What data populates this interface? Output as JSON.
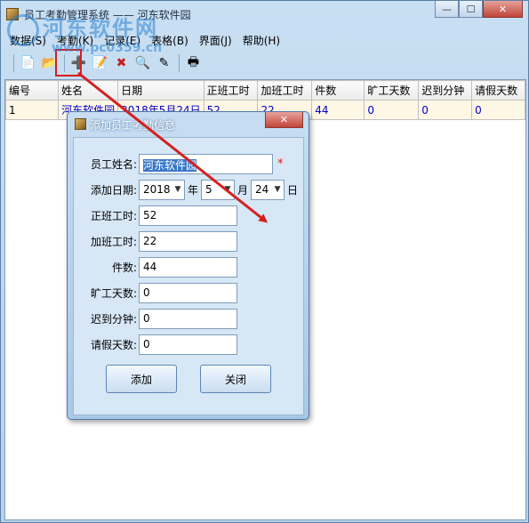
{
  "window": {
    "title": "员工考勤管理系统 —— 河东软件园",
    "controls": {
      "minimize": "—",
      "maximize": "☐",
      "close": "✕"
    }
  },
  "watermark": {
    "text": "河东软件网",
    "url": "www.pc0359.cn"
  },
  "menubar": {
    "items": [
      {
        "label": "数据(S)"
      },
      {
        "label": "考勤(K)"
      },
      {
        "label": "记录(E)"
      },
      {
        "label": "表格(B)"
      },
      {
        "label": "界面(J)"
      },
      {
        "label": "帮助(H)"
      }
    ]
  },
  "toolbar": {
    "buttons": [
      {
        "icon": "new-document-icon",
        "glyph": "📄"
      },
      {
        "icon": "open-folder-icon",
        "glyph": "📂"
      },
      {
        "icon": "add-record-icon",
        "glyph": "➕"
      },
      {
        "icon": "edit-document-icon",
        "glyph": "📝"
      },
      {
        "icon": "delete-icon",
        "glyph": "✖"
      },
      {
        "icon": "search-document-icon",
        "glyph": "🔍"
      },
      {
        "icon": "pencil-icon",
        "glyph": "✎"
      },
      {
        "icon": "printer-icon",
        "glyph": "🖶"
      }
    ]
  },
  "grid": {
    "columns": [
      "编号",
      "姓名",
      "日期",
      "正班工时",
      "加班工时",
      "件数",
      "旷工天数",
      "迟到分钟",
      "请假天数"
    ],
    "rows": [
      [
        "1",
        "河东软件园",
        "2018年5月24日",
        "52",
        "22",
        "44",
        "0",
        "0",
        "0"
      ]
    ]
  },
  "dialog": {
    "title": "添加员工考勤信息",
    "close": "✕",
    "fields": {
      "name": {
        "label": "员工姓名:",
        "value": "河东软件园",
        "required": "*"
      },
      "date": {
        "label": "添加日期:",
        "year": "2018",
        "year_unit": "年",
        "month": "5",
        "month_unit": "月",
        "day": "24",
        "day_unit": "日"
      },
      "regular_hours": {
        "label": "正班工时:",
        "value": "52"
      },
      "overtime_hours": {
        "label": "加班工时:",
        "value": "22"
      },
      "pieces": {
        "label": "件数:",
        "value": "44"
      },
      "absent_days": {
        "label": "旷工天数:",
        "value": "0"
      },
      "late_minutes": {
        "label": "迟到分钟:",
        "value": "0"
      },
      "leave_days": {
        "label": "请假天数:",
        "value": "0"
      }
    },
    "buttons": {
      "add": "添加",
      "close": "关闭"
    }
  },
  "colors": {
    "highlight": "#d42020",
    "selection": "#3a78c8",
    "cell_text": "#0000c8"
  }
}
